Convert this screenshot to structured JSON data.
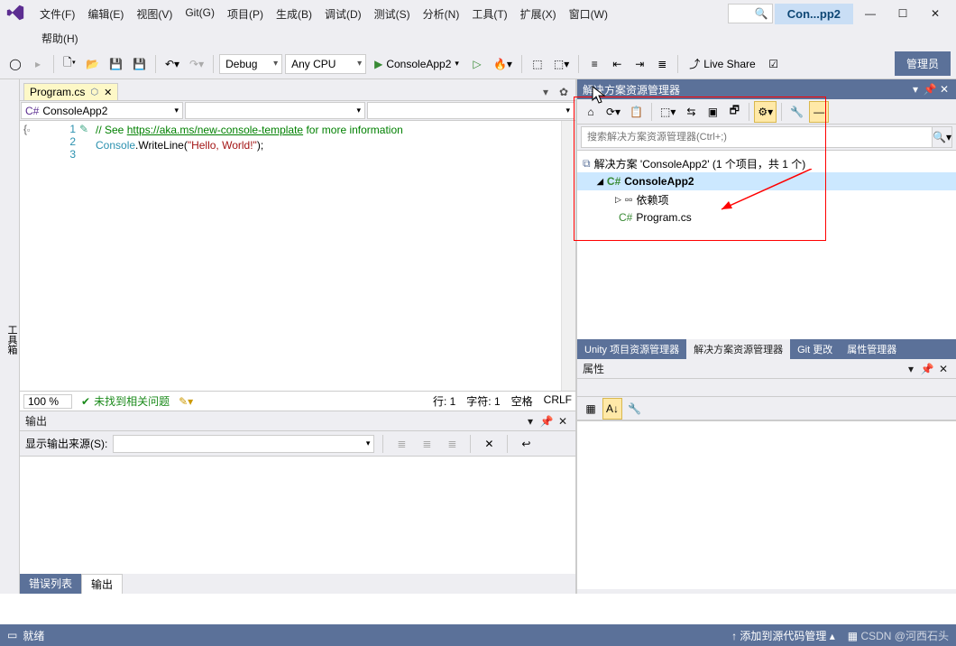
{
  "menubar": {
    "file": "文件(F)",
    "edit": "编辑(E)",
    "view": "视图(V)",
    "git": "Git(G)",
    "project": "项目(P)",
    "build": "生成(B)",
    "debug": "调试(D)",
    "test": "测试(S)",
    "analyze": "分析(N)",
    "tools": "工具(T)",
    "extensions": "扩展(X)",
    "window": "窗口(W)",
    "help": "帮助(H)"
  },
  "title": {
    "app": "Con...pp2"
  },
  "toolbar": {
    "config": "Debug",
    "platform": "Any CPU",
    "runTarget": "ConsoleApp2",
    "liveShare": "Live Share",
    "admin": "管理员"
  },
  "leftTool": "工具箱",
  "editor": {
    "tab": "Program.cs",
    "navLeft": "ConsoleApp2",
    "lines": [
      "1",
      "2",
      "3"
    ],
    "code": {
      "l1a": "// See ",
      "l1b": "https://aka.ms/new-console-template",
      "l1c": " for more information",
      "l2a": "Console",
      "l2b": ".WriteLine(",
      "l2c": "\"Hello, World!\"",
      "l2d": ");"
    },
    "status": {
      "zoom": "100 %",
      "noIssues": "未找到相关问题",
      "line": "行: 1",
      "char": "字符: 1",
      "space": "空格",
      "crlf": "CRLF"
    }
  },
  "output": {
    "title": "输出",
    "sourceLabel": "显示输出来源(S):",
    "tabs": {
      "errors": "错误列表",
      "output": "输出"
    }
  },
  "solutionExplorer": {
    "title": "解决方案资源管理器",
    "searchPlaceholder": "搜索解决方案资源管理器(Ctrl+;)",
    "root": "解决方案 'ConsoleApp2' (1 个项目，共 1 个)",
    "project": "ConsoleApp2",
    "deps": "依赖项",
    "file": "Program.cs",
    "tabs": {
      "unity": "Unity 项目资源管理器",
      "solution": "解决方案资源管理器",
      "gitChanges": "Git 更改",
      "propMgr": "属性管理器"
    }
  },
  "properties": {
    "title": "属性"
  },
  "bottomBar": {
    "ready": "就绪",
    "addSrc": "添加到源代码管理",
    "watermark": "CSDN @河西石头"
  }
}
